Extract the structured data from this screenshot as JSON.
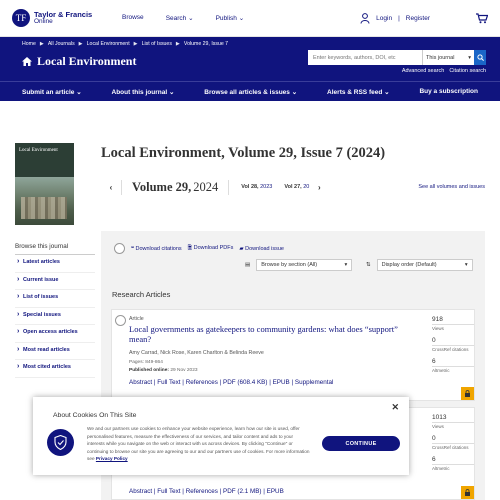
{
  "brand": {
    "logo_line1": "Taylor & Francis",
    "logo_line2": "Online"
  },
  "topnav": {
    "browse": "Browse",
    "search": "Search",
    "publish": "Publish"
  },
  "account": {
    "login": "Login",
    "separator": "|",
    "register": "Register"
  },
  "breadcrumbs": [
    "Home",
    "All Journals",
    "Local Environment",
    "List of Issues",
    "Volume 29, Issue 7"
  ],
  "journal": {
    "title": "Local Environment"
  },
  "search": {
    "placeholder": "Enter keywords, authors, DOI, etc",
    "scope": "This journal",
    "advanced": "Advanced search",
    "citation": "Citation search"
  },
  "mainnav": [
    "Submit an article",
    "About this journal",
    "Browse all articles & issues",
    "Alerts & RSS feed",
    "Buy a subscription"
  ],
  "cover": {
    "title": "Local Environment"
  },
  "issue": {
    "heading": "Local Environment, Volume 29, Issue 7 (2024)",
    "current_volume": "Volume 29,",
    "current_year": "2024",
    "prev_label": "Vol 28,",
    "prev_year": "2023",
    "next_label": "Vol 27,",
    "next_year": "20",
    "see_all": "See all volumes and issues"
  },
  "sidebar": {
    "heading": "Browse this journal",
    "items": [
      "Latest articles",
      "Current issue",
      "List of issues",
      "Special issues",
      "Open access articles",
      "Most read articles",
      "Most cited articles"
    ]
  },
  "toolbar": {
    "download_citations": "Download citations",
    "download_pdfs": "Download PDFs",
    "download_issue": "Download issue",
    "section_select": "Browse by section (All)",
    "order_select": "Display order (Default)"
  },
  "section": {
    "heading": "Research Articles"
  },
  "articles": [
    {
      "type": "Article",
      "title": "Local governments as gatekeepers to community gardens: what does “support” mean?",
      "authors": "Amy Carrad, Nick Rose, Karen Charlton & Belinda Reeve",
      "pages": "Pages: 849-864",
      "published_label": "Published online:",
      "published": "29 Nov 2023",
      "links": "Abstract | Full Text | References | PDF (608.4 KB) | EPUB | Supplemental",
      "metrics": [
        {
          "value": "918",
          "label": "Views"
        },
        {
          "value": "0",
          "label": "CrossRef citations"
        },
        {
          "value": "6",
          "label": "Altmetric"
        }
      ]
    },
    {
      "links": "Abstract | Full Text | References | PDF (2.1 MB) | EPUB",
      "metrics": [
        {
          "value": "1013",
          "label": "Views"
        },
        {
          "value": "0",
          "label": "CrossRef citations"
        },
        {
          "value": "6",
          "label": "Altmetric"
        }
      ]
    }
  ],
  "cookie": {
    "title": "About Cookies On This Site",
    "text": "We and our partners use cookies to enhance your website experience, learn how our site is used, offer personalised features, measure the effectiveness of our services, and tailor content and ads to your interests while you navigate on the web or interact with us across devices. By clicking \"Continue\" or continuing to browse our site you are agreeing to our and our partners use of cookies. For more information see",
    "policy_link": "Privacy Policy",
    "button": "CONTINUE"
  },
  "colors": {
    "brand": "#10147e",
    "link": "#10147e",
    "lock": "#f0a500"
  }
}
